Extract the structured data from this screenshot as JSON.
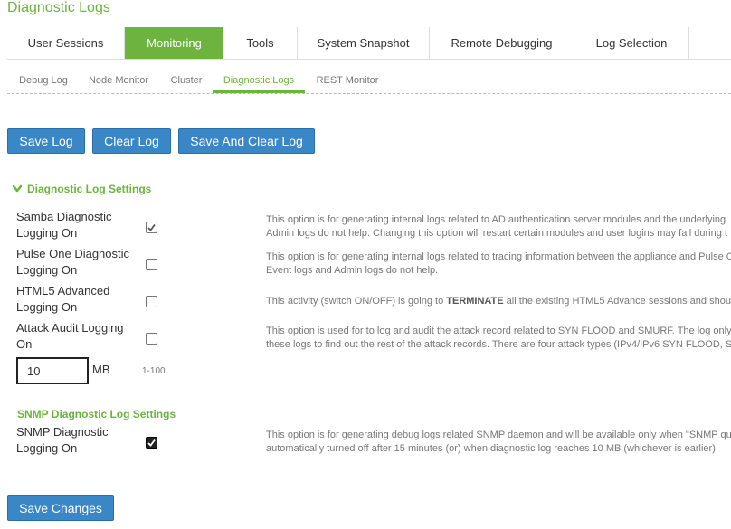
{
  "page": {
    "title": "Diagnostic Logs"
  },
  "main_tabs": [
    {
      "label": "User Sessions"
    },
    {
      "label": "Monitoring"
    },
    {
      "label": "Tools"
    },
    {
      "label": "System Snapshot"
    },
    {
      "label": "Remote Debugging"
    },
    {
      "label": "Log Selection"
    }
  ],
  "main_tabs_active": "Monitoring",
  "sub_tabs": [
    {
      "label": "Debug Log"
    },
    {
      "label": "Node Monitor"
    },
    {
      "label": "Cluster"
    },
    {
      "label": "Diagnostic Logs"
    },
    {
      "label": "REST Monitor"
    }
  ],
  "sub_tabs_active": "Diagnostic Logs",
  "actions": {
    "save_log": "Save Log",
    "clear_log": "Clear Log",
    "save_and_clear_log": "Save And Clear Log"
  },
  "diagnostic_settings": {
    "header": "Diagnostic Log Settings",
    "items": [
      {
        "label": "Samba Diagnostic Logging On",
        "checked": true,
        "desc_line1": "This option is for generating internal logs related to AD authentication server modules and the underlying",
        "desc_line2": "Admin logs do not help. Changing this option will restart certain modules and user logins may fail during t"
      },
      {
        "label": "Pulse One Diagnostic Logging On",
        "checked": false,
        "desc_line1": "This option is for generating internal logs related to tracing information between the appliance and Pulse O",
        "desc_line2": "Event logs and Admin logs do not help."
      },
      {
        "label": "HTML5 Advanced Logging On",
        "checked": false,
        "desc_pre": "This activity (switch ON/OFF) is going to ",
        "desc_bold": "TERMINATE",
        "desc_post": " all the existing HTML5 Advance sessions and shou"
      },
      {
        "label": "Attack Audit Logging On",
        "checked": false,
        "desc_line1": "This option is used for to log and audit the attack record related to SYN FLOOD and SMURF. The log only",
        "desc_line2": "these logs to find out the rest of the attack records. There are four attack types (IPv4/IPv6 SYN FLOOD, S"
      }
    ],
    "log_size": {
      "value": "10",
      "unit": "MB",
      "range": "1-100"
    }
  },
  "snmp_settings": {
    "header": "SNMP Diagnostic Log Settings",
    "item": {
      "label": "SNMP Diagnostic Logging On",
      "checked": true,
      "desc_line1": "This option is for generating debug logs related SNMP daemon and will be available only when \"SNMP qu",
      "desc_line2": "automatically turned off after 15 minutes (or) when diagnostic log reaches 10 MB (whichever is earlier)"
    }
  },
  "footer": {
    "save_changes": "Save Changes"
  },
  "colors": {
    "accent_green": "#6cb33f",
    "button_blue": "#3a87c8"
  },
  "icons": {
    "section_toggle": "chevron-down-icon",
    "checkmark": "checkmark-icon"
  }
}
